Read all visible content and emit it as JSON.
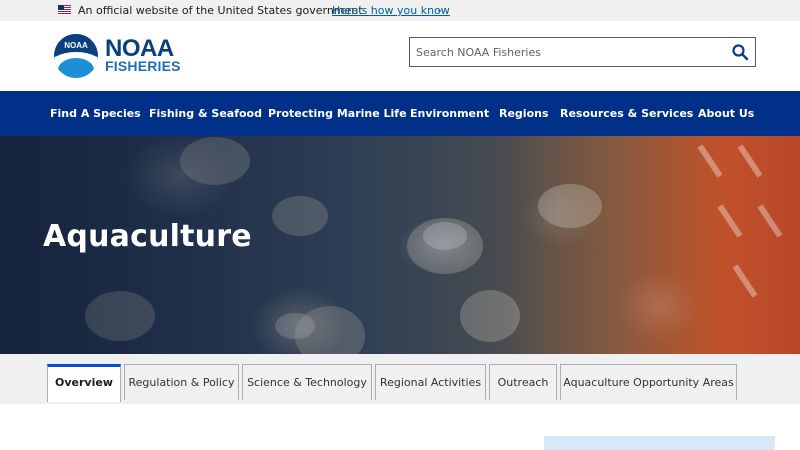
{
  "gov_banner": {
    "text": "An official website of the United States government",
    "link": "Here’s how you know"
  },
  "header": {
    "logo_badge": "NOAA",
    "logo_main": "NOAA",
    "logo_sub": "FISHERIES",
    "search_placeholder": "Search NOAA Fisheries"
  },
  "nav": {
    "items": [
      {
        "label": "Find A Species"
      },
      {
        "label": "Fishing & Seafood"
      },
      {
        "label": "Protecting Marine Life"
      },
      {
        "label": "Environment"
      },
      {
        "label": "Regions"
      },
      {
        "label": "Resources & Services"
      },
      {
        "label": "About Us"
      }
    ]
  },
  "hero": {
    "title": "Aquaculture"
  },
  "tabs": [
    {
      "label": "Overview",
      "active": true
    },
    {
      "label": "Regulation & Policy"
    },
    {
      "label": "Science & Technology"
    },
    {
      "label": "Regional Activities"
    },
    {
      "label": "Outreach"
    },
    {
      "label": "Aquaculture Opportunity Areas"
    }
  ],
  "colors": {
    "nav_bg": "#003087",
    "accent": "#0050d8",
    "link": "#005ea2"
  }
}
